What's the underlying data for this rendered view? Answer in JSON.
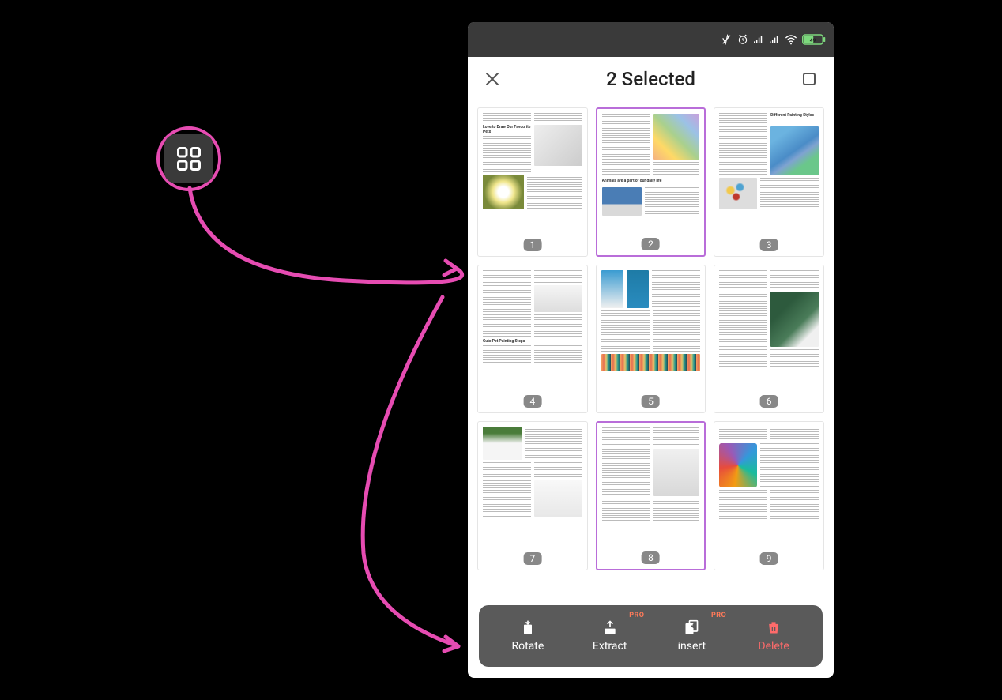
{
  "colors": {
    "accent_pink": "#e64cb2",
    "selected_purple": "#b96dd9",
    "danger": "#ff6b6b",
    "pro": "#ff7a59"
  },
  "status": {
    "battery": "49"
  },
  "header": {
    "title": "2 Selected"
  },
  "pages": [
    {
      "num": "1",
      "selected": false,
      "title": "Love to Draw Our Favourite Pets"
    },
    {
      "num": "2",
      "selected": true,
      "title": "Animals are a part of our daily life"
    },
    {
      "num": "3",
      "selected": false,
      "title": "Different Painting Styles"
    },
    {
      "num": "4",
      "selected": false,
      "title": "Cute Pet Painting Steps"
    },
    {
      "num": "5",
      "selected": false,
      "title": ""
    },
    {
      "num": "6",
      "selected": false,
      "title": ""
    },
    {
      "num": "7",
      "selected": false,
      "title": ""
    },
    {
      "num": "8",
      "selected": true,
      "title": ""
    },
    {
      "num": "9",
      "selected": false,
      "title": ""
    }
  ],
  "toolbar": {
    "rotate": "Rotate",
    "extract": "Extract",
    "insert": "insert",
    "delete": "Delete",
    "pro": "PRO"
  }
}
